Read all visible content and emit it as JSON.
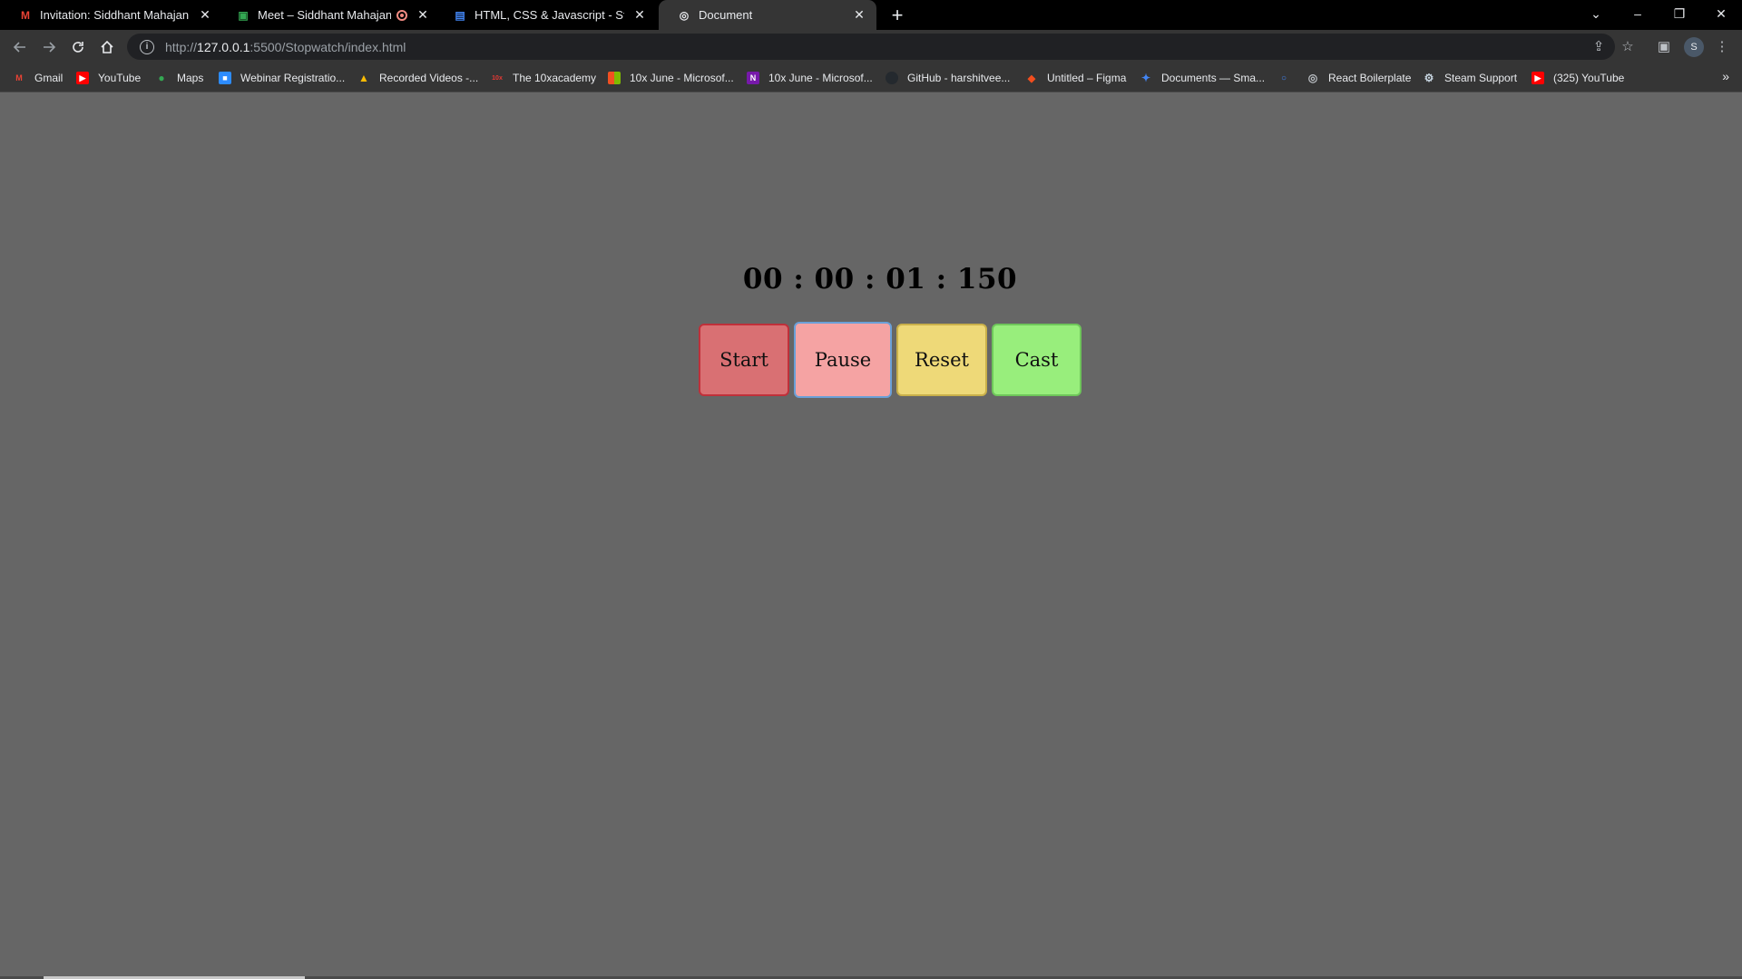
{
  "browser": {
    "tabs": [
      {
        "title": "Invitation: Siddhant Mahajan | Co",
        "favicon": "gmail-icon",
        "color": "#ea4335"
      },
      {
        "title": "Meet – Siddhant Mahajan | C",
        "favicon": "meet-icon",
        "color": "#34a853"
      },
      {
        "title": "HTML, CSS & Javascript - Stopwa",
        "favicon": "docs-icon",
        "color": "#4285f4"
      },
      {
        "title": "Document",
        "favicon": "globe-icon",
        "color": "#e8eaed"
      }
    ],
    "new_tab": "+",
    "window_controls": {
      "list": "⌄",
      "minimize": "–",
      "restore": "❐",
      "close": "✕"
    },
    "address": {
      "prefix": "http://",
      "host": "127.0.0.1",
      "rest": ":5500/Stopwatch/index.html"
    },
    "profile_initial": "S"
  },
  "bookmarks": [
    {
      "label": "Gmail",
      "icon": "gmail-icon",
      "color": "#ea4335",
      "glyph": "M"
    },
    {
      "label": "YouTube",
      "icon": "youtube-icon",
      "color": "#ff0000",
      "glyph": "▶"
    },
    {
      "label": "Maps",
      "icon": "maps-icon",
      "color": "#34a853",
      "glyph": "●"
    },
    {
      "label": "Webinar Registratio...",
      "icon": "zoom-icon",
      "color": "#2d8cff",
      "glyph": "■"
    },
    {
      "label": "Recorded Videos -...",
      "icon": "drive-icon",
      "color": "#fbbc04",
      "glyph": "▲"
    },
    {
      "label": "The 10xacademy",
      "icon": "10x-icon",
      "color": "#e53935",
      "glyph": "10x"
    },
    {
      "label": "10x June - Microsof...",
      "icon": "microsoft-icon",
      "color": "#f25022",
      "glyph": "■"
    },
    {
      "label": "10x June - Microsof...",
      "icon": "onenote-icon",
      "color": "#7719aa",
      "glyph": "N"
    },
    {
      "label": "GitHub - harshitvee...",
      "icon": "github-icon",
      "color": "#24292e",
      "glyph": "●"
    },
    {
      "label": "Untitled – Figma",
      "icon": "figma-icon",
      "color": "#f24e1e",
      "glyph": "◆"
    },
    {
      "label": "Documents — Sma...",
      "icon": "smallpdf-icon",
      "color": "#4285f4",
      "glyph": "✦"
    },
    {
      "label": "",
      "icon": "search-icon",
      "color": "#4285f4",
      "glyph": "🔍"
    },
    {
      "label": "React Boilerplate",
      "icon": "globe-icon",
      "color": "#bdc1c6",
      "glyph": "◎"
    },
    {
      "label": "Steam Support",
      "icon": "steam-icon",
      "color": "#c7d5e0",
      "glyph": "⚙"
    },
    {
      "label": "(325) YouTube",
      "icon": "youtube-icon",
      "color": "#ff0000",
      "glyph": "▶"
    }
  ],
  "stopwatch": {
    "display": "00 : 00 : 01 : 150",
    "buttons": {
      "start": "Start",
      "pause": "Pause",
      "reset": "Reset",
      "cast": "Cast"
    }
  }
}
